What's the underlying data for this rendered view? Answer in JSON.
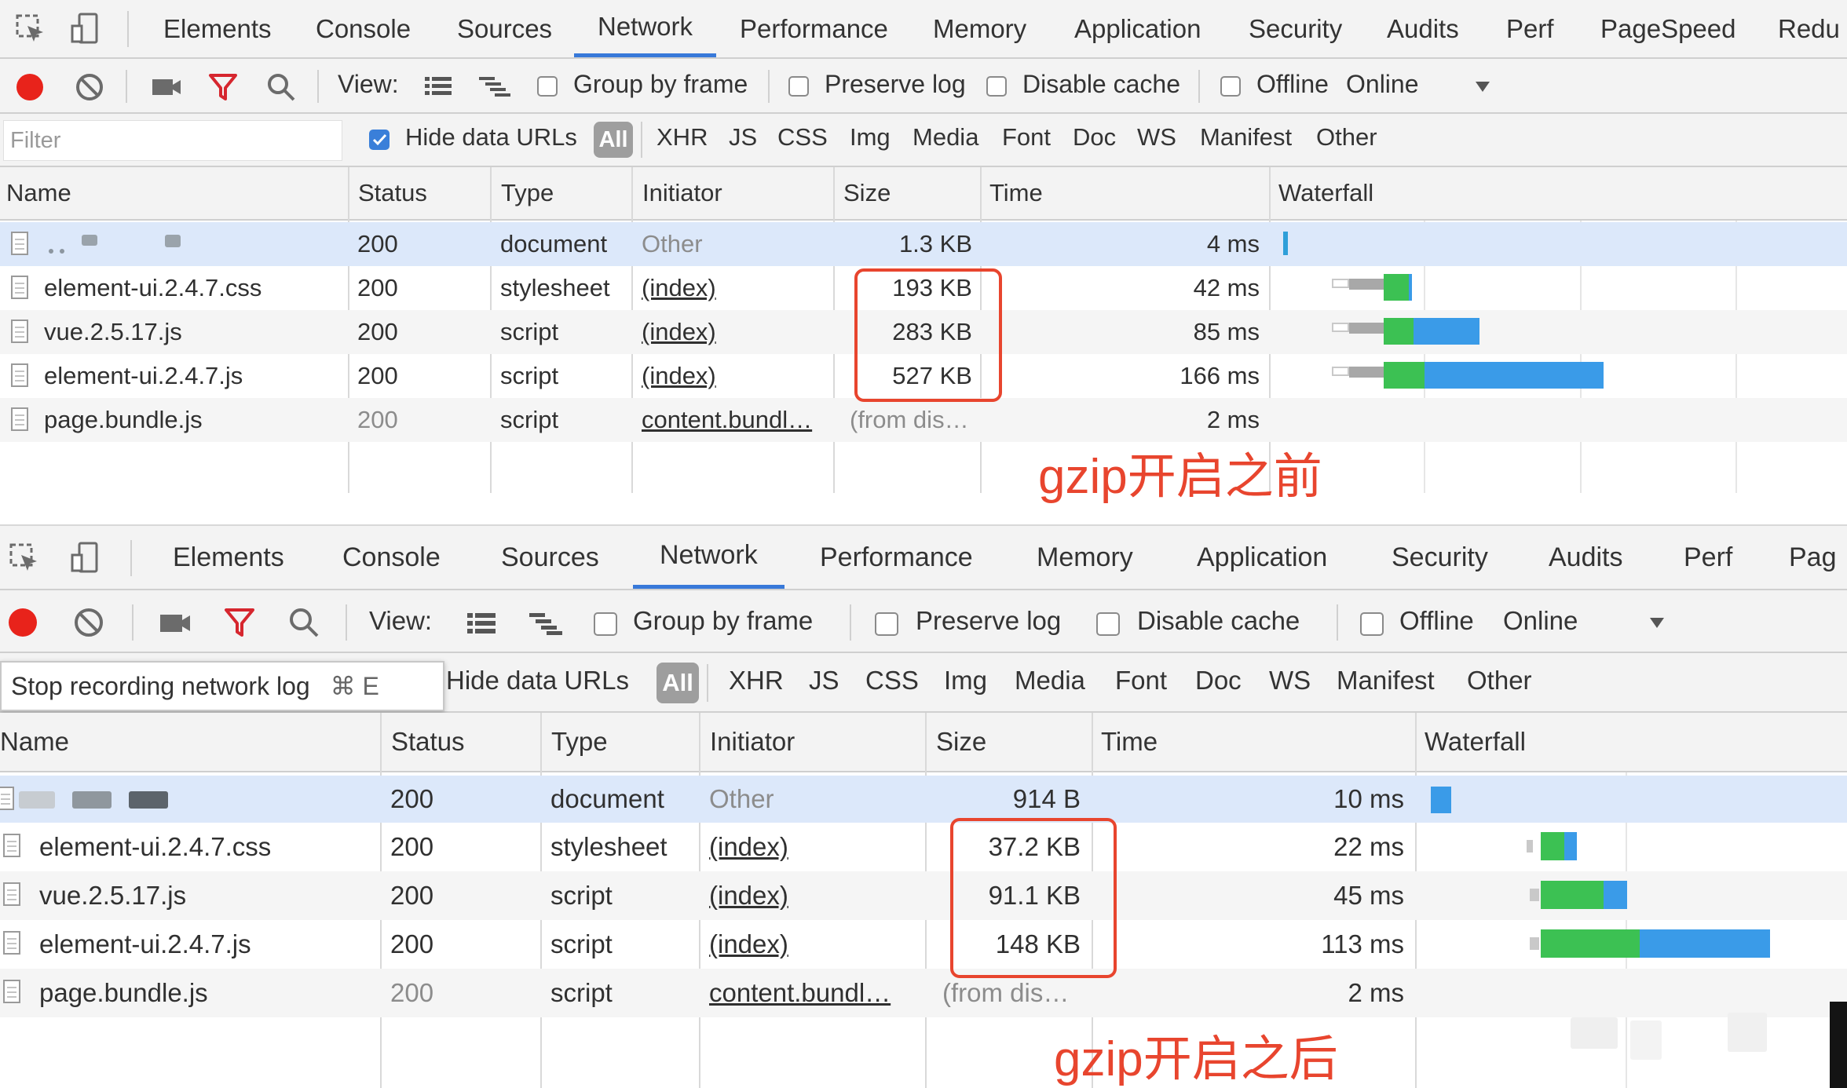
{
  "tabs": [
    "Elements",
    "Console",
    "Sources",
    "Network",
    "Performance",
    "Memory",
    "Application",
    "Security",
    "Audits",
    "Perf",
    "PageSpeed",
    "Redu"
  ],
  "tabs_bottom": [
    "Elements",
    "Console",
    "Sources",
    "Network",
    "Performance",
    "Memory",
    "Application",
    "Security",
    "Audits",
    "Perf",
    "Pag"
  ],
  "active_tab": "Network",
  "toolbar": {
    "view_label": "View:",
    "group_by_frame": "Group by frame",
    "preserve_log": "Preserve log",
    "disable_cache": "Disable cache",
    "offline": "Offline",
    "throttle": "Online"
  },
  "filterbar": {
    "filter_placeholder": "Filter",
    "hide_data_urls": "Hide data URLs",
    "all": "All",
    "types": [
      "XHR",
      "JS",
      "CSS",
      "Img",
      "Media",
      "Font",
      "Doc",
      "WS",
      "Manifest",
      "Other"
    ]
  },
  "columns": [
    "Name",
    "Status",
    "Type",
    "Initiator",
    "Size",
    "Time",
    "Waterfall"
  ],
  "tooltip": {
    "text": "Stop recording network log",
    "shortcut": "⌘ E"
  },
  "before": {
    "rows": [
      {
        "name": "",
        "status": "200",
        "type": "document",
        "initiator": "Other",
        "size": "1.3 KB",
        "time": "4 ms"
      },
      {
        "name": "element-ui.2.4.7.css",
        "status": "200",
        "type": "stylesheet",
        "initiator": "(index)",
        "size": "193 KB",
        "time": "42 ms"
      },
      {
        "name": "vue.2.5.17.js",
        "status": "200",
        "type": "script",
        "initiator": "(index)",
        "size": "283 KB",
        "time": "85 ms"
      },
      {
        "name": "element-ui.2.4.7.js",
        "status": "200",
        "type": "script",
        "initiator": "(index)",
        "size": "527 KB",
        "time": "166 ms"
      },
      {
        "name": "page.bundle.js",
        "status": "200",
        "type": "script",
        "initiator": "content.bundl…",
        "size": "(from dis…",
        "time": "2 ms"
      }
    ],
    "annotation": "gzip开启之前"
  },
  "after": {
    "rows": [
      {
        "name": "",
        "status": "200",
        "type": "document",
        "initiator": "Other",
        "size": "914 B",
        "time": "10 ms"
      },
      {
        "name": "element-ui.2.4.7.css",
        "status": "200",
        "type": "stylesheet",
        "initiator": "(index)",
        "size": "37.2 KB",
        "time": "22 ms"
      },
      {
        "name": "vue.2.5.17.js",
        "status": "200",
        "type": "script",
        "initiator": "(index)",
        "size": "91.1 KB",
        "time": "45 ms"
      },
      {
        "name": "element-ui.2.4.7.js",
        "status": "200",
        "type": "script",
        "initiator": "(index)",
        "size": "148 KB",
        "time": "113 ms"
      },
      {
        "name": "page.bundle.js",
        "status": "200",
        "type": "script",
        "initiator": "content.bundl…",
        "size": "(from dis…",
        "time": "2 ms"
      }
    ],
    "annotation": "gzip开启之后"
  },
  "colors": {
    "accent": "#3879d9",
    "record": "#e8231b",
    "filter_icon": "#d6262e",
    "annotation": "#e8452e",
    "waterfall_wait": "#a8a8a8",
    "waterfall_ttfb": "#3cc153",
    "waterfall_download": "#3a9be8"
  },
  "icons": [
    "inspect-icon",
    "device-toggle-icon",
    "record-icon",
    "clear-icon",
    "camera-icon",
    "filter-icon",
    "search-icon",
    "list-view-icon",
    "waterfall-view-icon",
    "dropdown-arrow-icon",
    "document-file-icon"
  ]
}
